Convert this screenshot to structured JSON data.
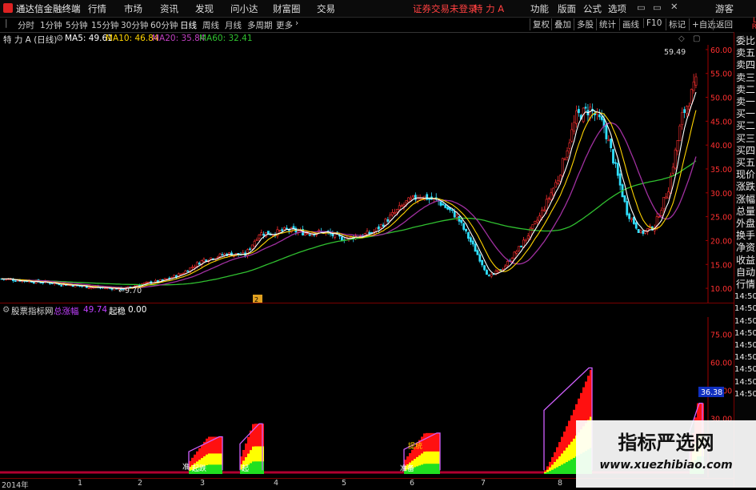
{
  "titlebar": {
    "app_name": "通达信金融终端",
    "menus": [
      "行情",
      "市场",
      "资讯",
      "发现",
      "问小达",
      "财富圈",
      "交易"
    ],
    "login_status": "证券交易未登录",
    "stock_name": "特 力 A",
    "right_menus": [
      "功能",
      "版面",
      "公式",
      "选项"
    ],
    "user": "游客"
  },
  "toolbar": {
    "periods": [
      "分时",
      "1分钟",
      "5分钟",
      "15分钟",
      "30分钟",
      "60分钟",
      "日线",
      "周线",
      "月线",
      "多周期",
      "更多"
    ],
    "active_period": "日线",
    "right_tools": [
      "复权",
      "叠加",
      "多股",
      "统计",
      "画线",
      "F10",
      "标记",
      "+自选",
      "返回"
    ]
  },
  "legend": {
    "stock_label": "特 力 A (日线)",
    "ma": [
      {
        "label": "MA5: 49.61",
        "color": "#ffffff"
      },
      {
        "label": "MA10: 46.84",
        "color": "#ffd400"
      },
      {
        "label": "MA20: 35.84",
        "color": "#c040c0"
      },
      {
        "label": "MA60: 32.41",
        "color": "#30c030"
      }
    ]
  },
  "price_axis": {
    "labels": [
      "60.00",
      "55.00",
      "50.00",
      "45.00",
      "40.00",
      "35.00",
      "30.00",
      "25.00",
      "20.00",
      "15.00",
      "10.00"
    ],
    "high_marker": "59.49",
    "low_marker": "9.70",
    "event_marker": "2"
  },
  "indicator": {
    "name": "股票指标网",
    "field1_label": "总涨幅",
    "field1_value": "49.74",
    "field2_label": "起稳",
    "field2_value": "0.00",
    "axis_labels": [
      "75.00",
      "60.00",
      "45.00",
      "30.00"
    ],
    "current_value": "36.38",
    "bar_labels": [
      "准",
      "起跌",
      "起",
      "提统",
      "准备"
    ]
  },
  "date_axis": [
    "2014年",
    "1",
    "2",
    "3",
    "4",
    "5",
    "6",
    "7",
    "8"
  ],
  "rightpanel": {
    "corner_letters": [
      "L",
      "R"
    ],
    "items": [
      "委比",
      "卖五",
      "卖四",
      "卖三",
      "卖二",
      "卖一",
      "买一",
      "买二",
      "买三",
      "买四",
      "买五",
      "现价",
      "涨跌",
      "涨幅",
      "总量",
      "外盘",
      "换手",
      "净资",
      "收益",
      "自动",
      "行情",
      "14:50",
      "14:50",
      "14:50",
      "14:50",
      "14:50",
      "14:50",
      "14:50",
      "14:50",
      "14:50"
    ]
  },
  "watermark": {
    "title": "指标严选网",
    "url": "www.xuezhibiao.com"
  },
  "chart_data": {
    "type": "candlestick",
    "ma_periods": [
      5,
      10,
      20,
      60
    ],
    "high": 59.49,
    "low": 9.7,
    "ylim": [
      8,
      62
    ],
    "sub_ylim": [
      0,
      80
    ],
    "x_labels": [
      "2014年",
      "1",
      "2",
      "3",
      "4",
      "5",
      "6",
      "7",
      "8"
    ]
  }
}
